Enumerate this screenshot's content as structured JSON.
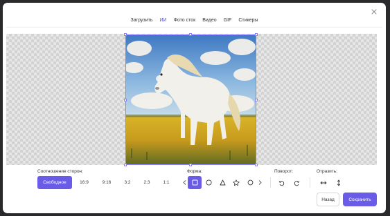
{
  "tabs": [
    {
      "label": "Загрузить",
      "active": false
    },
    {
      "label": "ИИ",
      "active": true
    },
    {
      "label": "Фото сток",
      "active": false
    },
    {
      "label": "Видео",
      "active": false
    },
    {
      "label": "GIF",
      "active": false
    },
    {
      "label": "Стикеры",
      "active": false
    }
  ],
  "close_icon": "×",
  "aspect_ratio": {
    "label": "Соотношение сторон:",
    "options": [
      "Свободное",
      "16:9",
      "9:16",
      "3:2",
      "2:3",
      "1:1"
    ],
    "selected": "Свободное"
  },
  "shape": {
    "label": "Форма:",
    "options": [
      "square-icon",
      "circle-icon",
      "triangle-icon",
      "star-icon",
      "circle-outline-icon"
    ],
    "selected": "square-icon"
  },
  "rotate": {
    "label": "Поворот:",
    "buttons": [
      "rotate-left-icon",
      "rotate-right-icon"
    ]
  },
  "flip": {
    "label": "Отразить:",
    "buttons": [
      "flip-horizontal-icon",
      "flip-vertical-icon"
    ]
  },
  "buttons": {
    "back": "Назад",
    "save": "Сохранить"
  },
  "colors": {
    "accent": "#6b5ce7",
    "accent_text": "#5b4fe0"
  }
}
